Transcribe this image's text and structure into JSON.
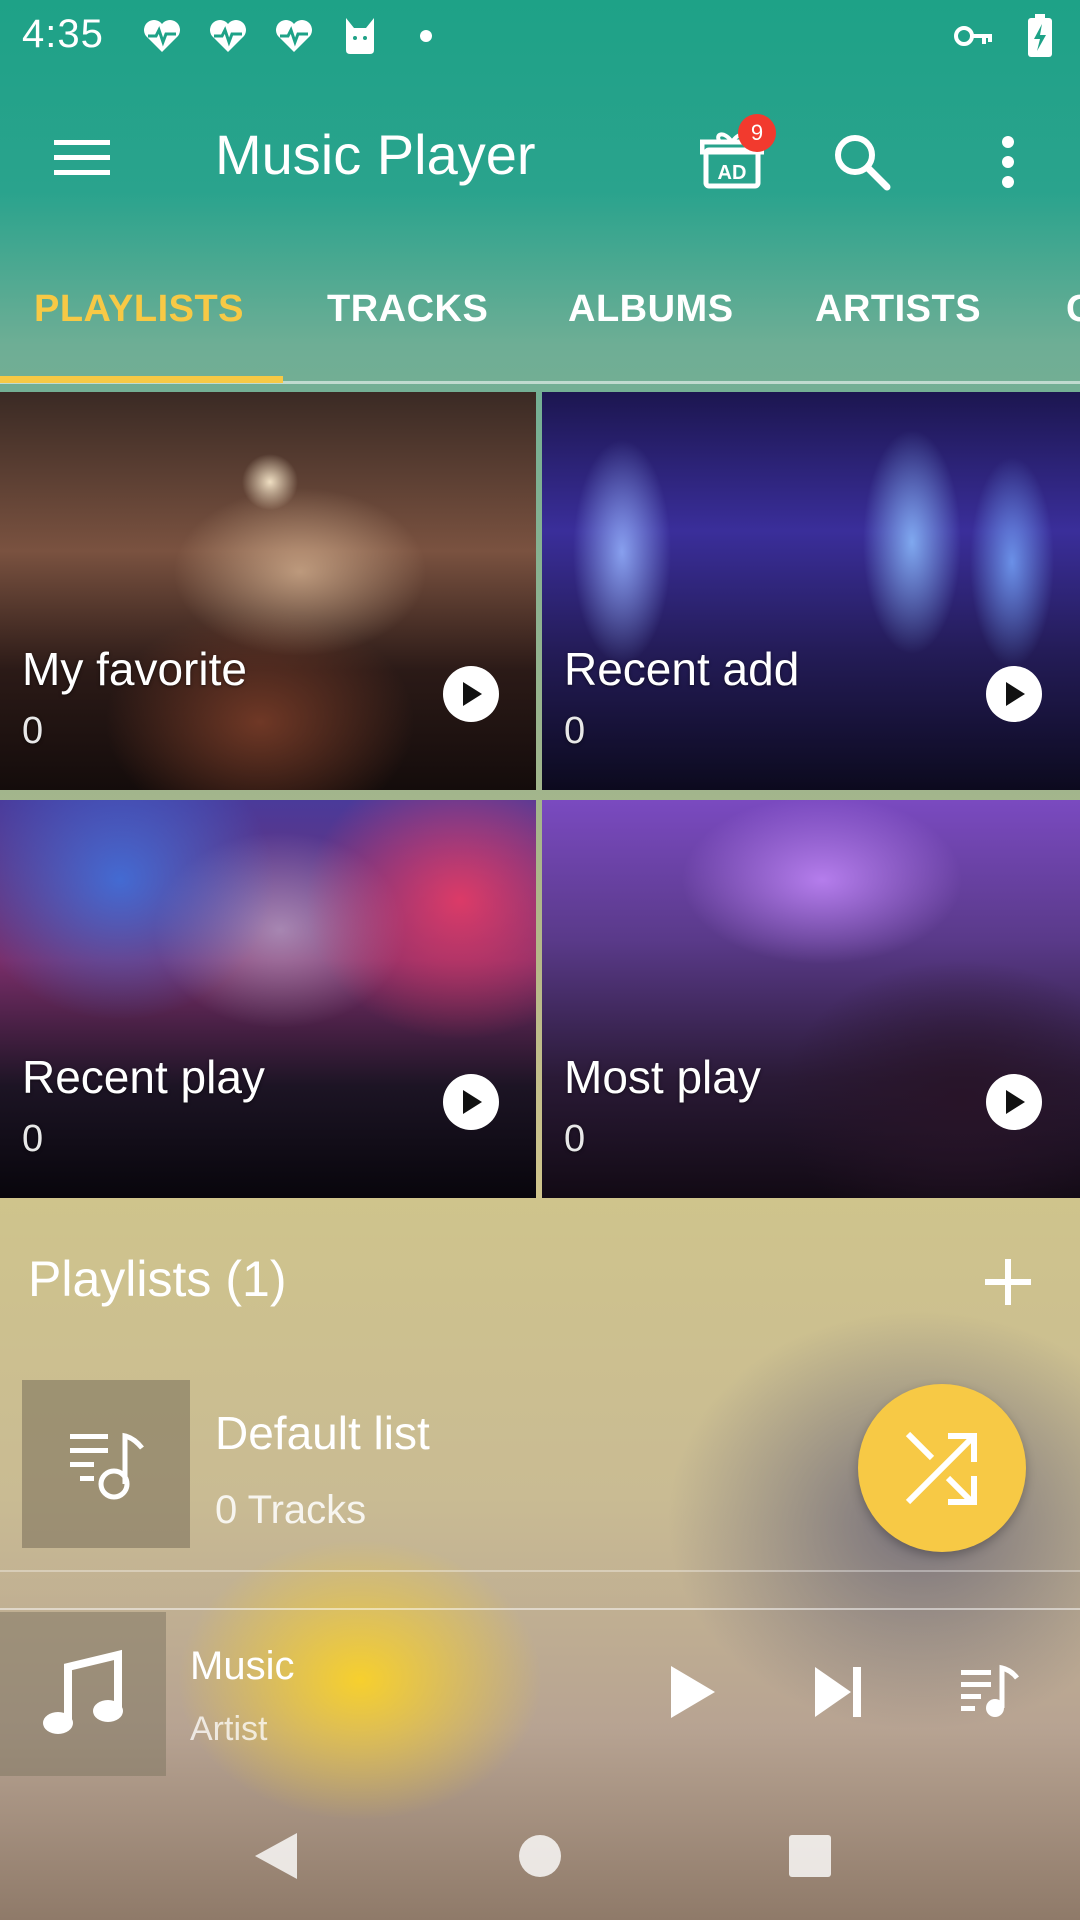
{
  "status_bar": {
    "time": "4:35",
    "left_icons": [
      "heart-pulse-icon",
      "heart-pulse-icon",
      "heart-pulse-icon",
      "cat-icon",
      "dot-icon"
    ],
    "right_icons": [
      "vpn-key-icon",
      "battery-charging-icon"
    ]
  },
  "app_bar": {
    "title": "Music Player",
    "ad_badge_count": "9",
    "ad_label": "AD"
  },
  "tabs": [
    {
      "label": "PLAYLISTS",
      "active": true
    },
    {
      "label": "TRACKS",
      "active": false
    },
    {
      "label": "ALBUMS",
      "active": false
    },
    {
      "label": "ARTISTS",
      "active": false
    },
    {
      "label": "G",
      "active": false
    }
  ],
  "cards": [
    {
      "title": "My favorite",
      "count": "0"
    },
    {
      "title": "Recent add",
      "count": "0"
    },
    {
      "title": "Recent play",
      "count": "0"
    },
    {
      "title": "Most play",
      "count": "0"
    }
  ],
  "playlists_section": {
    "title": "Playlists",
    "count": "(1)",
    "items": [
      {
        "name": "Default list",
        "tracks": "0 Tracks"
      }
    ]
  },
  "mini_player": {
    "title": "Music",
    "artist": "Artist"
  },
  "colors": {
    "accent": "#f7c945",
    "badge": "#f23a2e",
    "app_bar_teal": "#1ea287"
  }
}
